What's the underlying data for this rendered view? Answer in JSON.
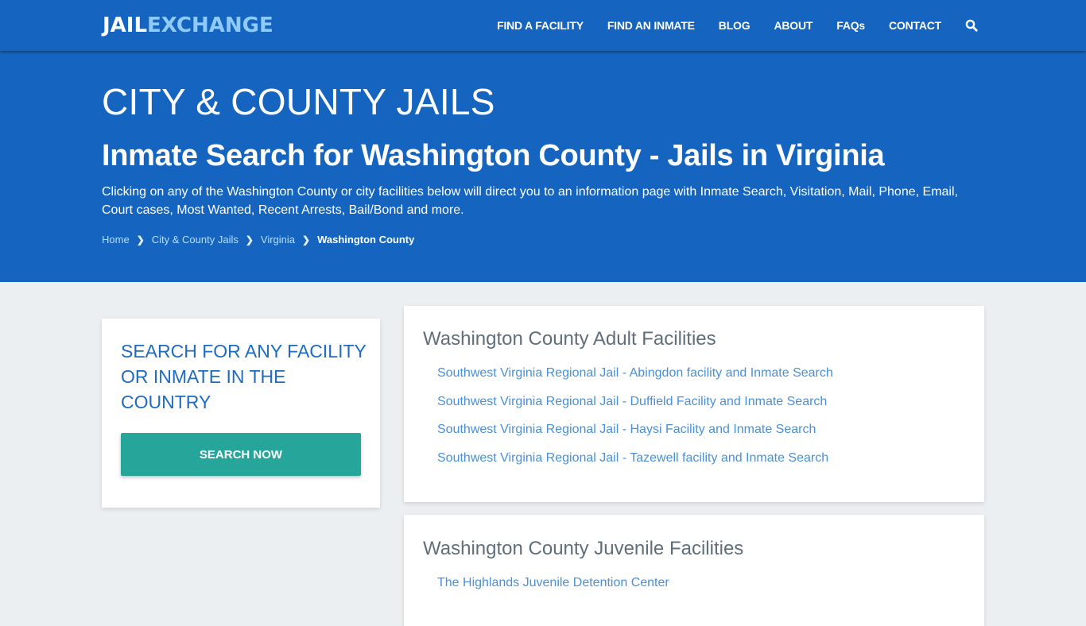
{
  "brand": {
    "part1": "JAIL",
    "part2": "EXCHANGE"
  },
  "nav": {
    "items": [
      "FIND A FACILITY",
      "FIND AN INMATE",
      "BLOG",
      "ABOUT",
      "FAQs",
      "CONTACT"
    ],
    "search_icon": "search-icon"
  },
  "hero": {
    "title": "CITY & COUNTY JAILS",
    "subtitle": "Inmate Search for Washington County - Jails in Virginia",
    "description": "Clicking on any of the Washington County or city facilities below will direct you to an information page with Inmate Search, Visitation, Mail, Phone, Email, Court cases, Most Wanted, Recent Arrests, Bail/Bond and more.",
    "breadcrumb": [
      "Home",
      "City & County Jails",
      "Virginia",
      "Washington County"
    ]
  },
  "search_card": {
    "heading": "SEARCH FOR ANY FACILITY OR INMATE IN THE COUNTRY",
    "button_label": "SEARCH NOW"
  },
  "adult_facilities": {
    "heading": "Washington County Adult Facilities",
    "links": [
      "Southwest Virginia Regional Jail - Abingdon facility and Inmate Search",
      "Southwest Virginia Regional Jail - Duffield Facility and Inmate Search",
      "Southwest Virginia Regional Jail - Haysi Facility and Inmate Search",
      "Southwest Virginia Regional Jail - Tazewell facility and Inmate Search"
    ]
  },
  "juvenile_facilities": {
    "heading": "Washington County Juvenile Facilities",
    "links": [
      "The Highlands Juvenile Detention Center"
    ]
  },
  "colors": {
    "primary": "#1565c0",
    "accent": "#26a69a",
    "logo_accent": "#90caf9",
    "link": "#4a90d9"
  }
}
